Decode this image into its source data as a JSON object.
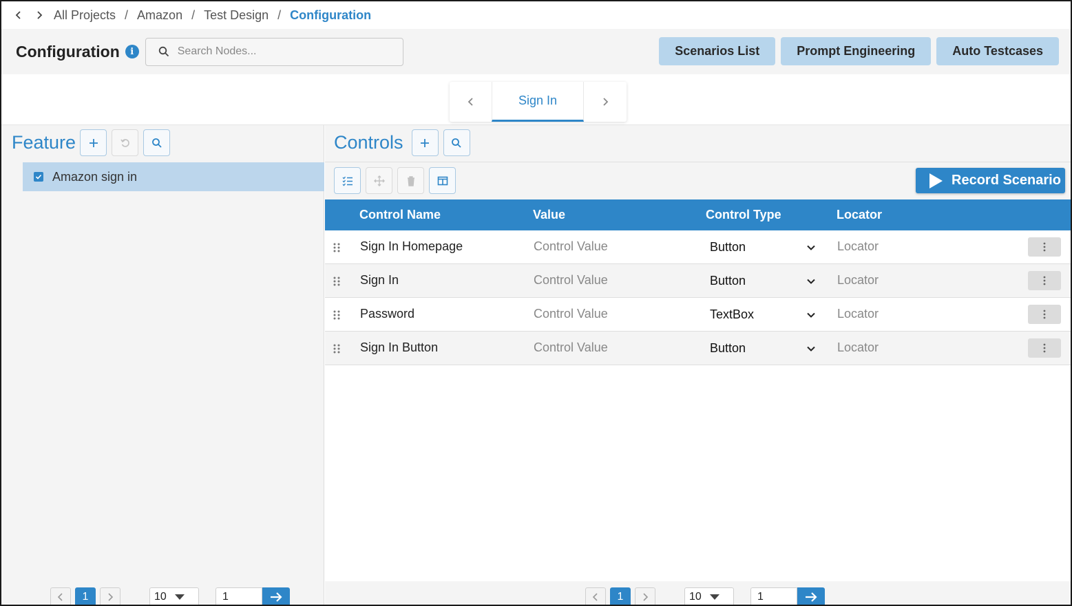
{
  "breadcrumb": {
    "items": [
      "All Projects",
      "Amazon",
      "Test Design"
    ],
    "current": "Configuration",
    "separator": "/"
  },
  "header": {
    "title": "Configuration",
    "info_glyph": "i",
    "search_placeholder": "Search Nodes...",
    "buttons": [
      "Scenarios List",
      "Prompt Engineering",
      "Auto Testcases"
    ]
  },
  "tabs": {
    "active": "Sign In"
  },
  "feature_panel": {
    "title": "Feature",
    "items": [
      {
        "label": "Amazon sign in",
        "checked": true
      }
    ],
    "pager": {
      "page": "1",
      "page_size": "10",
      "goto": "1"
    }
  },
  "controls_panel": {
    "title": "Controls",
    "record_label": "Record Scenario",
    "columns": [
      "Control Name",
      "Value",
      "Control Type",
      "Locator"
    ],
    "rows": [
      {
        "name": "Sign In Homepage",
        "value": "Control Value",
        "type": "Button",
        "locator": "Locator"
      },
      {
        "name": "Sign In",
        "value": "Control Value",
        "type": "Button",
        "locator": "Locator"
      },
      {
        "name": "Password",
        "value": "Control Value",
        "type": "TextBox",
        "locator": "Locator"
      },
      {
        "name": "Sign In Button",
        "value": "Control Value",
        "type": "Button",
        "locator": "Locator"
      }
    ],
    "pager": {
      "page": "1",
      "page_size": "10",
      "goto": "1"
    }
  },
  "colors": {
    "accent": "#2e86c8",
    "header_button_bg": "#b7d5ec",
    "selected_row_bg": "#bcd6ec"
  }
}
